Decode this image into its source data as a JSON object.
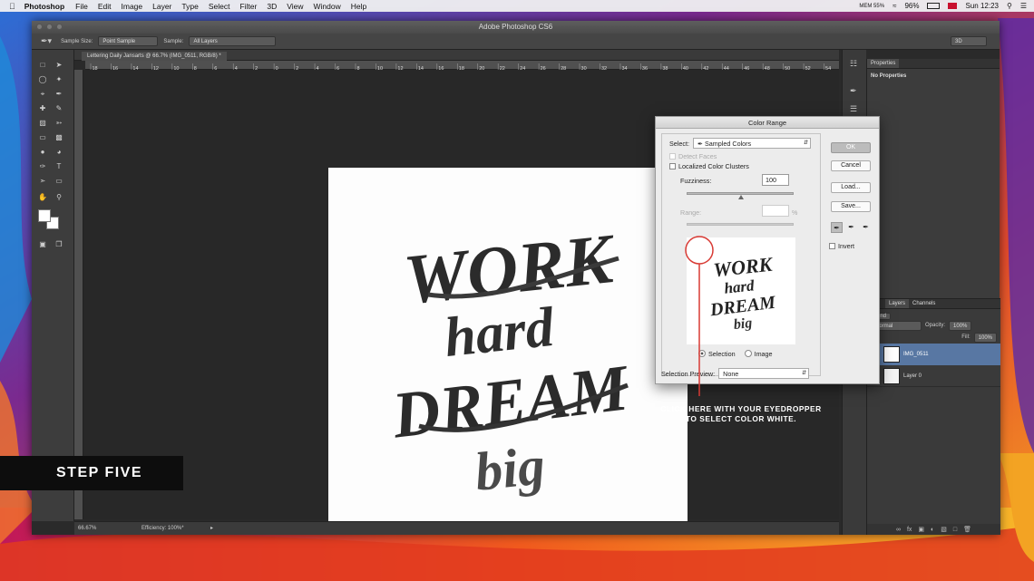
{
  "menubar": {
    "app": "Photoshop",
    "items": [
      "File",
      "Edit",
      "Image",
      "Layer",
      "Type",
      "Select",
      "Filter",
      "3D",
      "View",
      "Window",
      "Help"
    ],
    "battery": "96%",
    "clock": "Sun 12:23",
    "mem": "MEM 55%"
  },
  "window": {
    "title": "Adobe Photoshop CS6"
  },
  "options": {
    "sample_size_label": "Sample Size:",
    "sample_size_value": "Point Sample",
    "sample_label": "Sample:",
    "sample_value": "All Layers",
    "workspace": "3D"
  },
  "document": {
    "tab": "Lettering Daily Jansarts @ 66.7% (IMG_0511, RGB/8) *",
    "zoom": "66.67%",
    "status": "Efficiency: 100%*",
    "ruler_ticks": [
      "18",
      "16",
      "14",
      "12",
      "10",
      "8",
      "6",
      "4",
      "2",
      "0",
      "2",
      "4",
      "6",
      "8",
      "10",
      "12",
      "14",
      "16",
      "18",
      "20",
      "22",
      "24",
      "26",
      "28",
      "30",
      "32",
      "34",
      "36",
      "38",
      "40",
      "42",
      "44",
      "46",
      "48",
      "50",
      "52",
      "54"
    ]
  },
  "artwork": {
    "line1": "WORK",
    "line2": "hard",
    "line3": "DREAM",
    "line4": "big"
  },
  "properties": {
    "tab": "Properties",
    "content": "No Properties"
  },
  "layers": {
    "tabs": [
      "Layers",
      "Channels"
    ],
    "blend": "Normal",
    "opacity_label": "Opacity:",
    "opacity": "100%",
    "fill_label": "Fill:",
    "fill": "100%",
    "kind": "Kind",
    "items": [
      {
        "name": "IMG_0511"
      },
      {
        "name": "Layer 0"
      }
    ]
  },
  "dialog": {
    "title": "Color Range",
    "select_label": "Select:",
    "select_value": "Sampled Colors",
    "detect_faces": "Detect Faces",
    "localized": "Localized Color Clusters",
    "fuzziness_label": "Fuzziness:",
    "fuzziness": "100",
    "range_label": "Range:",
    "range_unit": "%",
    "selection_radio": "Selection",
    "image_radio": "Image",
    "preview_label": "Selection Preview:",
    "preview_value": "None",
    "ok": "OK",
    "cancel": "Cancel",
    "load": "Load...",
    "save": "Save...",
    "invert": "Invert"
  },
  "annotation": {
    "line1": "CLICK HERE WITH YOUR EYEDROPPER",
    "line2": "TO SELECT COLOR WHITE."
  },
  "step": "STEP FIVE",
  "colors": {
    "accent": "#d83a34",
    "panel": "#3c3c3c",
    "dialog": "#ececec"
  }
}
